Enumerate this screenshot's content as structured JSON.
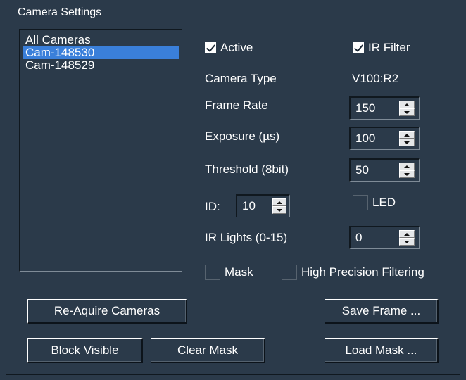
{
  "group_title": "Camera Settings",
  "cameras": {
    "items": [
      "All Cameras",
      "Cam-148530",
      "Cam-148529"
    ],
    "selected_index": 1
  },
  "checks": {
    "active": {
      "label": "Active",
      "checked": true
    },
    "ir_filter": {
      "label": "IR Filter",
      "checked": true
    },
    "led": {
      "label": "LED",
      "checked": false
    },
    "mask": {
      "label": "Mask",
      "checked": false
    },
    "high_precision": {
      "label": "High Precision Filtering",
      "checked": false
    }
  },
  "camera_type": {
    "label": "Camera Type",
    "value": "V100:R2"
  },
  "frame_rate": {
    "label": "Frame Rate",
    "value": "150"
  },
  "exposure": {
    "label": "Exposure (µs)",
    "value": "100"
  },
  "threshold": {
    "label": "Threshold (8bit)",
    "value": "50"
  },
  "id": {
    "label": "ID:",
    "value": "10"
  },
  "ir_lights": {
    "label": "IR Lights (0-15)",
    "value": "0"
  },
  "buttons": {
    "reacquire": "Re-Aquire Cameras",
    "save_frame": "Save Frame ...",
    "block_visible": "Block Visible",
    "clear_mask": "Clear Mask",
    "load_mask": "Load Mask ..."
  }
}
